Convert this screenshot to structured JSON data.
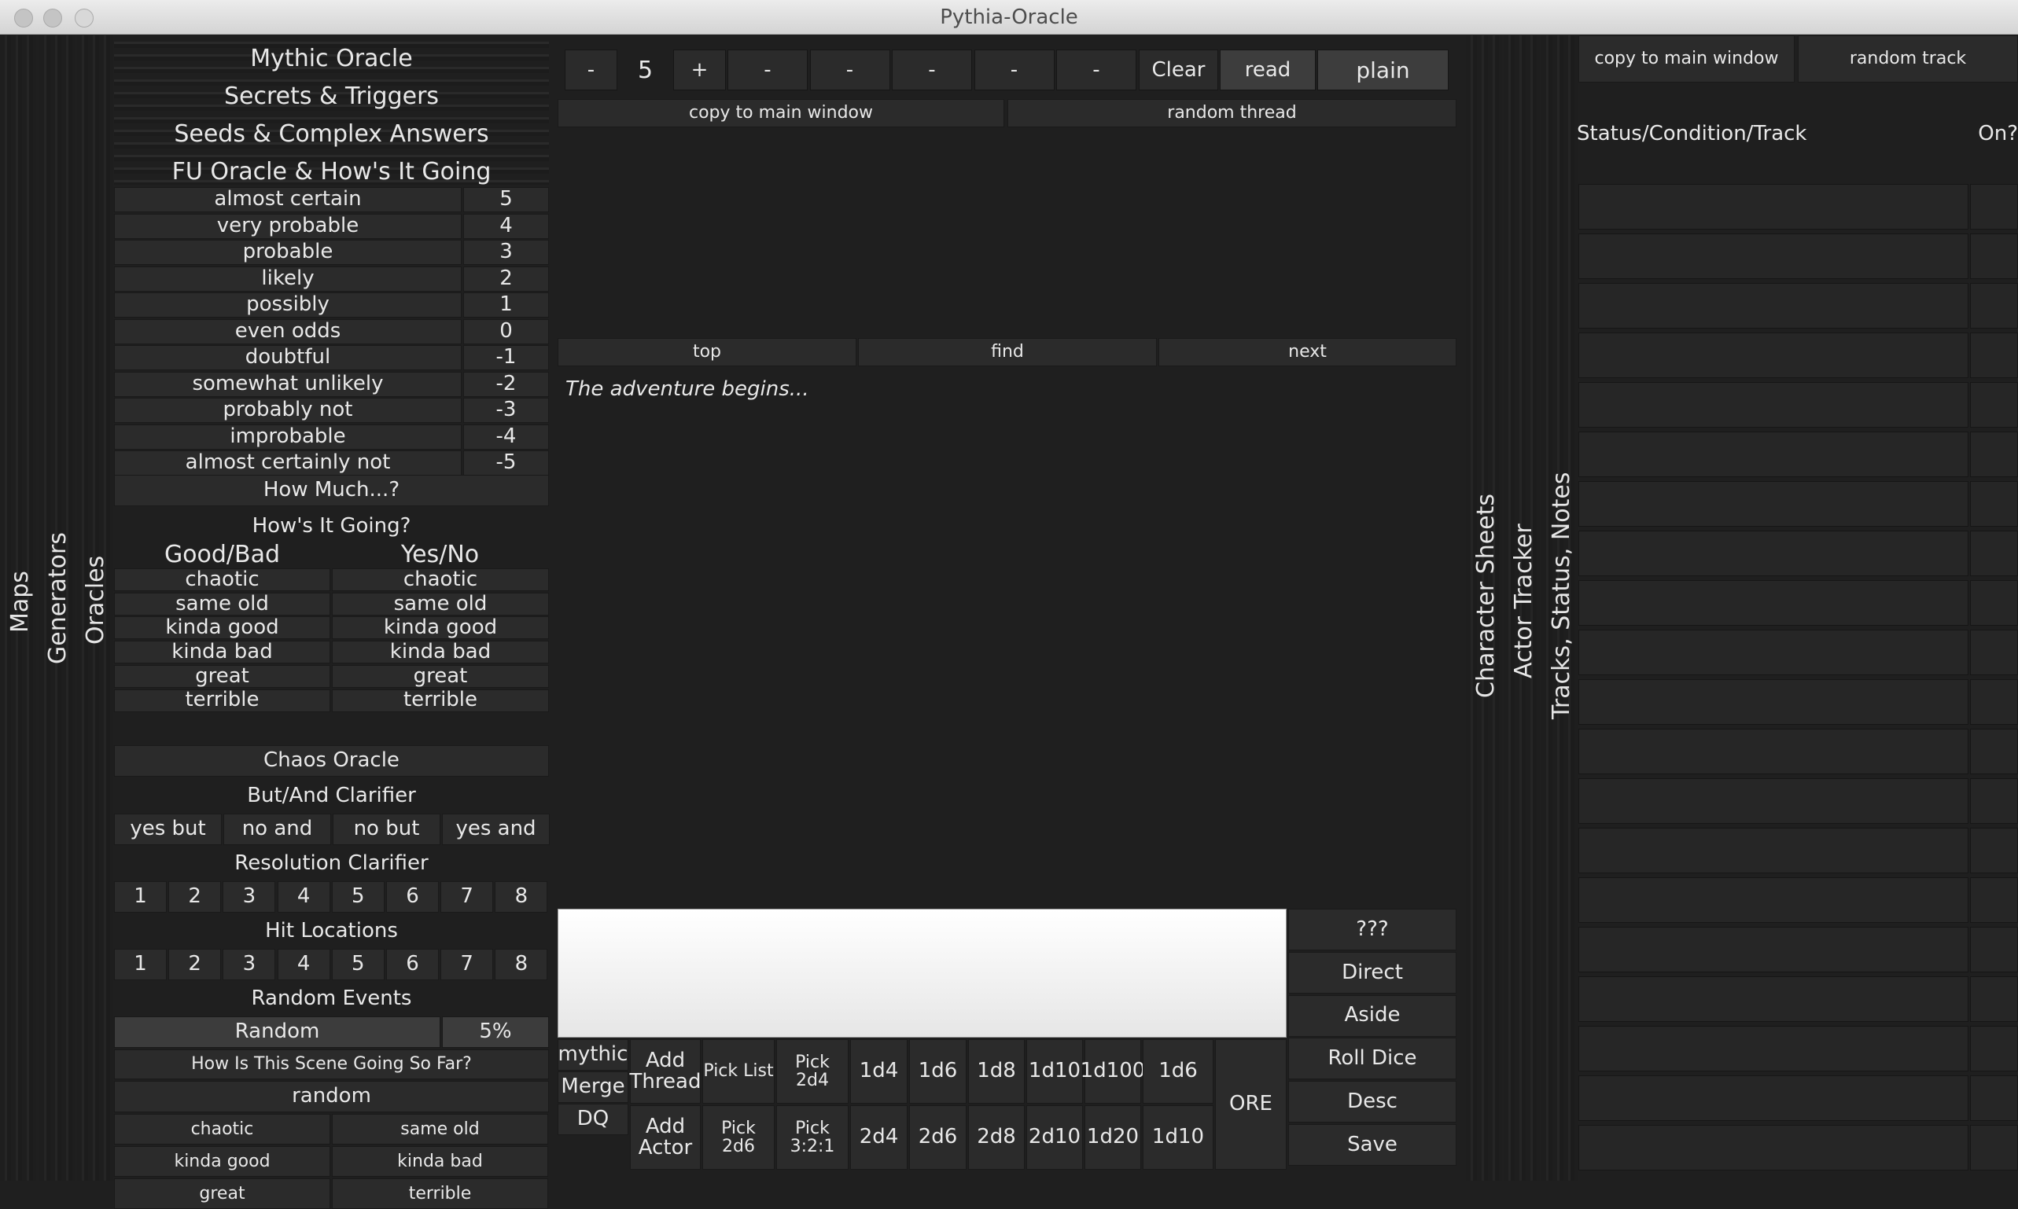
{
  "window": {
    "title": "Pythia-Oracle"
  },
  "left_tabs": [
    "Maps",
    "Generators",
    "Oracles"
  ],
  "oracle": {
    "headers": [
      "Mythic Oracle",
      "Secrets & Triggers",
      "Seeds & Complex Answers",
      "FU Oracle & How's It Going"
    ],
    "likelihood": [
      {
        "label": "almost certain",
        "value": "5"
      },
      {
        "label": "very probable",
        "value": "4"
      },
      {
        "label": "probable",
        "value": "3"
      },
      {
        "label": "likely",
        "value": "2"
      },
      {
        "label": "possibly",
        "value": "1"
      },
      {
        "label": "even odds",
        "value": "0"
      },
      {
        "label": "doubtful",
        "value": "-1"
      },
      {
        "label": "somewhat unlikely",
        "value": "-2"
      },
      {
        "label": "probably not",
        "value": "-3"
      },
      {
        "label": "improbable",
        "value": "-4"
      },
      {
        "label": "almost certainly not",
        "value": "-5"
      }
    ],
    "how_much": "How Much...?",
    "hows_it_going": "How's It Going?",
    "good_bad": "Good/Bad",
    "yes_no": "Yes/No",
    "going_rows": [
      "chaotic",
      "same old",
      "kinda good",
      "kinda bad",
      "great",
      "terrible"
    ],
    "chaos_oracle": "Chaos Oracle",
    "but_and_title": "But/And Clarifier",
    "but_and": [
      "yes but",
      "no and",
      "no but",
      "yes and"
    ],
    "resolution_title": "Resolution Clarifier",
    "numbers": [
      "1",
      "2",
      "3",
      "4",
      "5",
      "6",
      "7",
      "8"
    ],
    "hit_title": "Hit Locations",
    "random_events_title": "Random Events",
    "random_label": "Random",
    "random_pct": "5%",
    "scene_title": "How Is This Scene Going So Far?",
    "scene_random": "random",
    "scene_grid": [
      [
        "chaotic",
        "same old"
      ],
      [
        "kinda good",
        "kinda bad"
      ],
      [
        "great",
        "terrible"
      ]
    ]
  },
  "toolbar": {
    "minus": "-",
    "chaos": "5",
    "plus": "+",
    "dashes": [
      "-",
      "-",
      "-",
      "-",
      "-"
    ],
    "clear": "Clear",
    "read": "read",
    "plain": "plain"
  },
  "thread": {
    "copy": "copy to main window",
    "random": "random thread"
  },
  "search": {
    "top": "top",
    "find": "find",
    "next": "next"
  },
  "log": {
    "text": "The adventure begins..."
  },
  "side_buttons": [
    "???",
    "Direct",
    "Aside",
    "Roll Dice",
    "Desc",
    "Save"
  ],
  "bottom": {
    "col1": [
      "mythic",
      "Merge",
      "DQ"
    ],
    "add_thread": "Add Thread",
    "add_actor": "Add Actor",
    "pick_list": "Pick List",
    "pick_2d4": "Pick 2d4",
    "pick_2d6": "Pick 2d6",
    "pick_321": "Pick 3:2:1",
    "dice_row1": [
      "1d4",
      "1d6",
      "1d8",
      "1d10",
      "1d100",
      "1d6"
    ],
    "dice_row2": [
      "2d4",
      "2d6",
      "2d8",
      "2d10",
      "1d20",
      "1d10"
    ],
    "ore": "ORE"
  },
  "right_tabs": [
    "Character Sheets",
    "Actor Tracker",
    "Tracks, Status, Notes"
  ],
  "tracks": {
    "copy": "copy to main window",
    "random": "random track",
    "col_status": "Status/Condition/Track",
    "col_on": "On?"
  }
}
